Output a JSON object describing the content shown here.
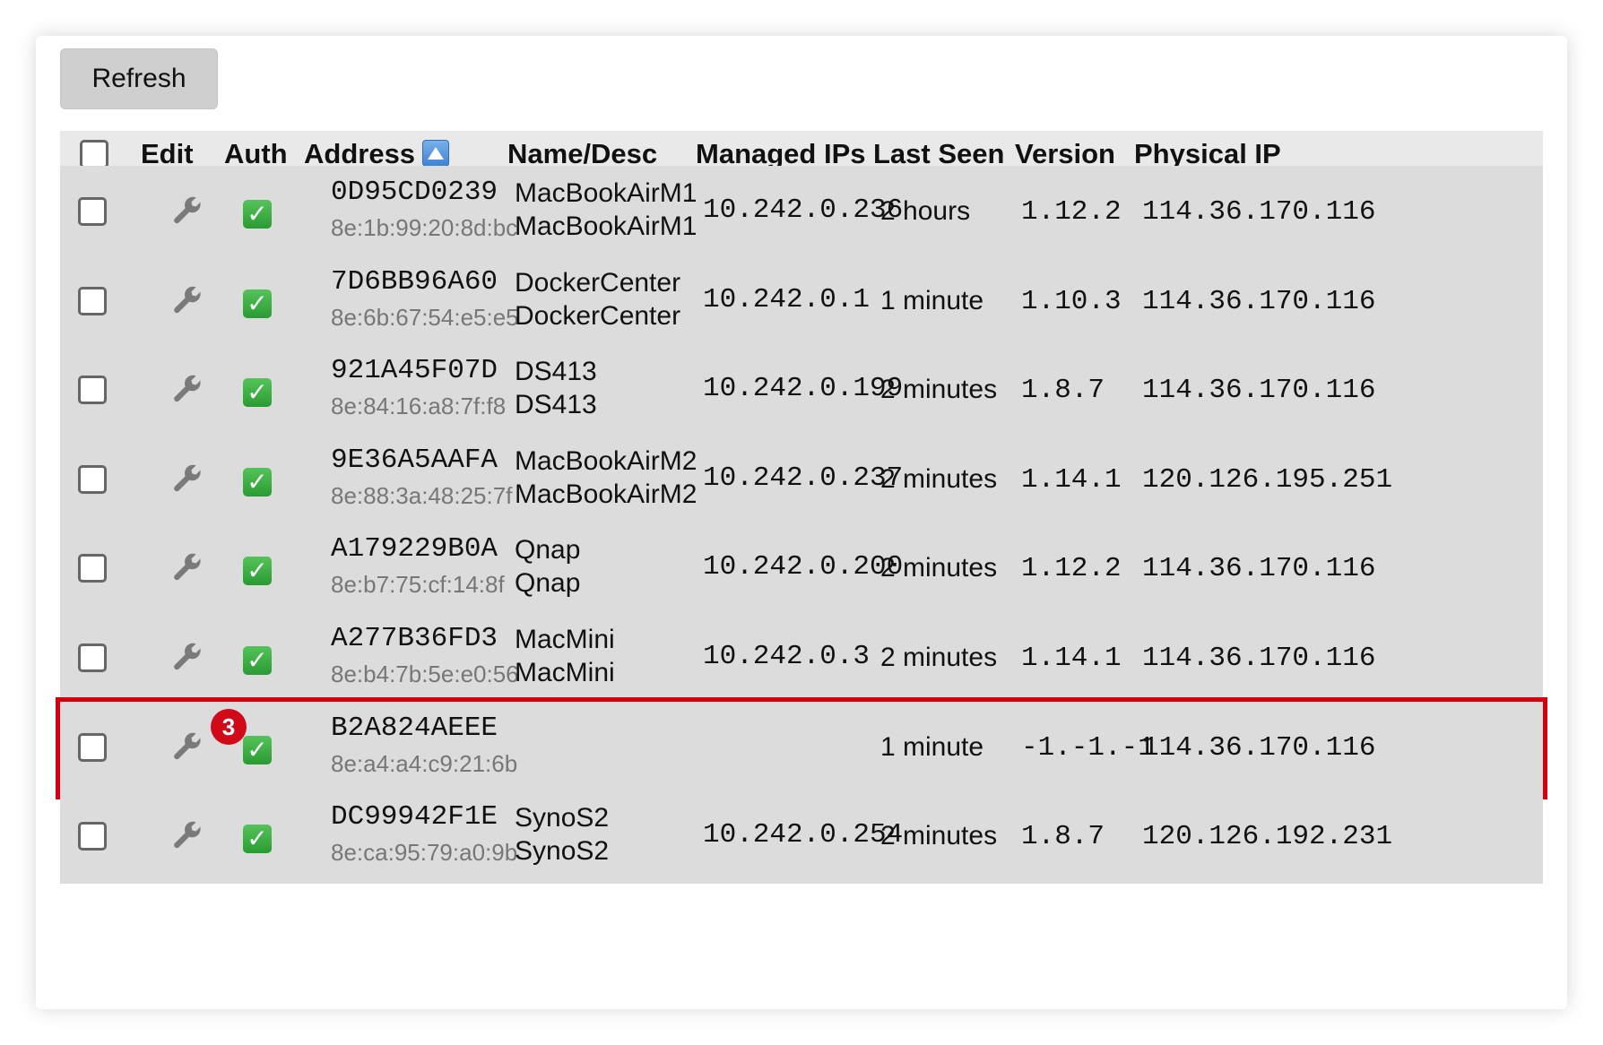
{
  "toolbar": {
    "refresh_label": "Refresh"
  },
  "table": {
    "headers": {
      "edit": "Edit",
      "auth": "Auth",
      "address": "Address",
      "name": "Name/Desc",
      "managed_ips": "Managed IPs",
      "last_seen": "Last Seen",
      "version": "Version",
      "physical_ip": "Physical IP"
    },
    "rows": [
      {
        "address": "0D95CD0239",
        "mac": "8e:1b:99:20:8d:bc",
        "name": "MacBookAirM1",
        "desc": "MacBookAirM1",
        "managed_ip": "10.242.0.236",
        "last_seen": "2 hours",
        "version": "1.12.2",
        "physical_ip": "114.36.170.116"
      },
      {
        "address": "7D6BB96A60",
        "mac": "8e:6b:67:54:e5:e5",
        "name": "DockerCenter",
        "desc": "DockerCenter",
        "managed_ip": "10.242.0.1",
        "last_seen": "1 minute",
        "version": "1.10.3",
        "physical_ip": "114.36.170.116"
      },
      {
        "address": "921A45F07D",
        "mac": "8e:84:16:a8:7f:f8",
        "name": "DS413",
        "desc": "DS413",
        "managed_ip": "10.242.0.199",
        "last_seen": "2 minutes",
        "version": "1.8.7",
        "physical_ip": "114.36.170.116"
      },
      {
        "address": "9E36A5AAFA",
        "mac": "8e:88:3a:48:25:7f",
        "name": "MacBookAirM2",
        "desc": "MacBookAirM2",
        "managed_ip": "10.242.0.237",
        "last_seen": "2 minutes",
        "version": "1.14.1",
        "physical_ip": "120.126.195.251"
      },
      {
        "address": "A179229B0A",
        "mac": "8e:b7:75:cf:14:8f",
        "name": "Qnap",
        "desc": "Qnap",
        "managed_ip": "10.242.0.200",
        "last_seen": "2 minutes",
        "version": "1.12.2",
        "physical_ip": "114.36.170.116"
      },
      {
        "address": "A277B36FD3",
        "mac": "8e:b4:7b:5e:e0:56",
        "name": "MacMini",
        "desc": "MacMini",
        "managed_ip": "10.242.0.3",
        "last_seen": "2 minutes",
        "version": "1.14.1",
        "physical_ip": "114.36.170.116"
      },
      {
        "address": "B2A824AEEE",
        "mac": "8e:a4:a4:c9:21:6b",
        "name": "",
        "desc": "",
        "managed_ip": "",
        "last_seen": "1 minute",
        "version": "-1.-1.-1",
        "physical_ip": "114.36.170.116",
        "badge": "3"
      },
      {
        "address": "DC99942F1E",
        "mac": "8e:ca:95:79:a0:9b",
        "name": "SynoS2",
        "desc": "SynoS2",
        "managed_ip": "10.242.0.254",
        "last_seen": "2 minutes",
        "version": "1.8.7",
        "physical_ip": "120.126.192.231"
      }
    ]
  },
  "icons": {
    "edit": "wrench-icon",
    "auth": "check-icon",
    "sort": "sort-ascending-icon"
  },
  "colors": {
    "highlight": "#d4000f",
    "badge": "#d10a1a",
    "auth_green": "#2a9a32",
    "sort_blue": "#3f82d6"
  }
}
